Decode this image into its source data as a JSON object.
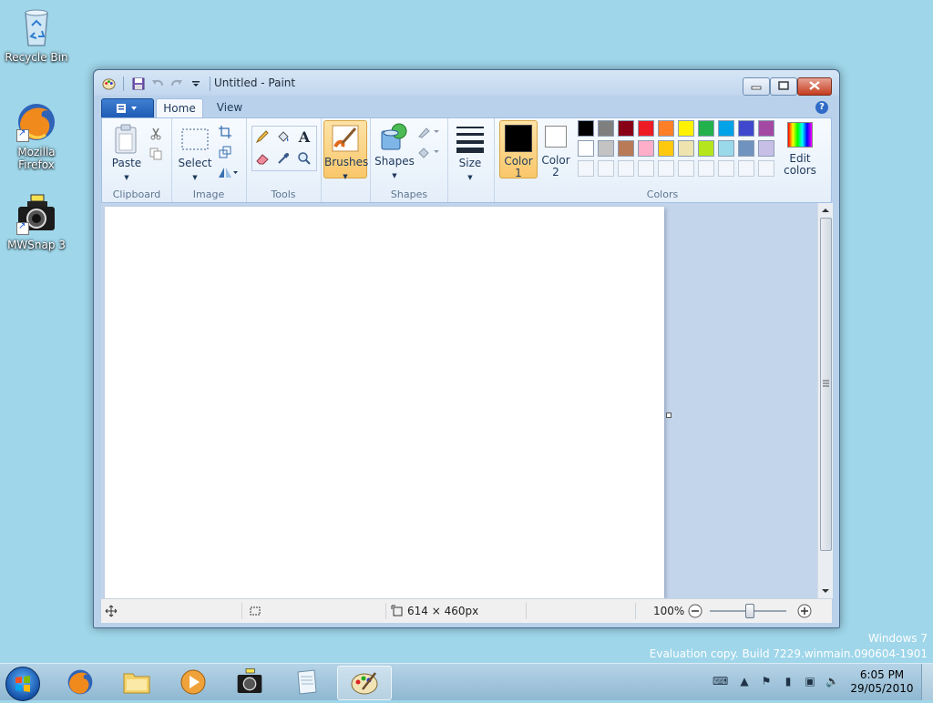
{
  "desktop": {
    "icons": [
      {
        "label": "Recycle Bin"
      },
      {
        "label": "Mozilla Firefox"
      },
      {
        "label": "MWSnap 3"
      }
    ],
    "watermark": {
      "line1": "Windows 7",
      "line2": "Evaluation copy. Build 7229.winmain.090604-1901"
    }
  },
  "window": {
    "title": "Untitled - Paint",
    "tabs": [
      {
        "label": "Home"
      },
      {
        "label": "View"
      }
    ],
    "ribbon": {
      "clipboard": {
        "paste_label": "Paste",
        "group_label": "Clipboard"
      },
      "image": {
        "select_label": "Select",
        "group_label": "Image"
      },
      "tools": {
        "group_label": "Tools",
        "text_tool_glyph": "A"
      },
      "brushes": {
        "label": "Brushes"
      },
      "shapes": {
        "label": "Shapes",
        "group_label": "Shapes"
      },
      "size": {
        "label": "Size"
      },
      "color1": {
        "line1": "Color",
        "line2": "1",
        "value": "#000000"
      },
      "color2": {
        "line1": "Color",
        "line2": "2",
        "value": "#ffffff"
      },
      "colors_group_label": "Colors",
      "edit_colors": {
        "line1": "Edit",
        "line2": "colors"
      },
      "palette_row1": [
        "#000000",
        "#7f7f7f",
        "#880015",
        "#ed1c24",
        "#ff7f27",
        "#fff200",
        "#22b14c",
        "#00a2e8",
        "#3f48cc",
        "#a349a4"
      ],
      "palette_row2": [
        "#ffffff",
        "#c3c3c3",
        "#b97a57",
        "#ffaec9",
        "#ffc90e",
        "#efe4b0",
        "#b5e61d",
        "#99d9ea",
        "#7092be",
        "#c8bfe7"
      ]
    },
    "status": {
      "dimensions": "614 × 460px",
      "zoom": "100%"
    },
    "accent": "#f9c76b"
  },
  "taskbar": {
    "clock_time": "6:05 PM",
    "clock_date": "29/05/2010"
  }
}
